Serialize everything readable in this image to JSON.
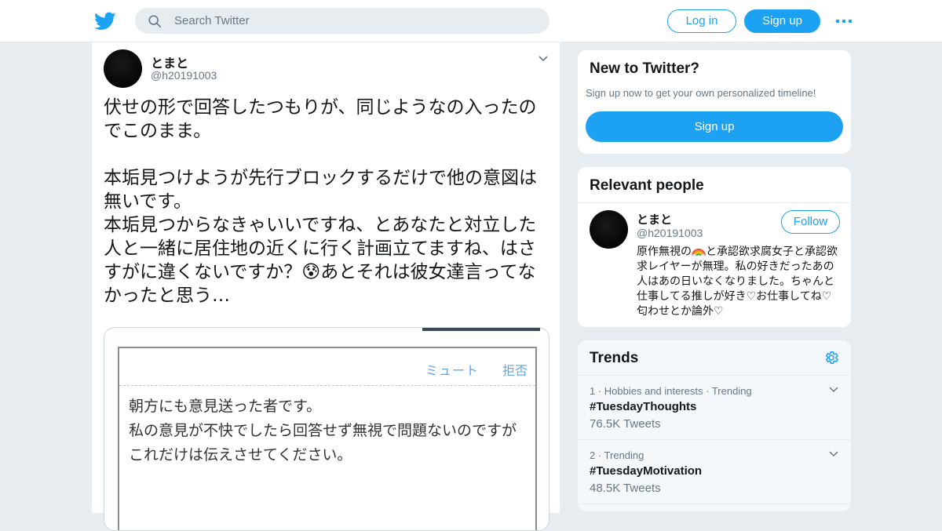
{
  "header": {
    "search_placeholder": "Search Twitter",
    "login_label": "Log in",
    "signup_label": "Sign up"
  },
  "tweet": {
    "name": "とまと",
    "handle": "@h20191003",
    "text": "伏せの形で回答したつもりが、同じようなの入ったのでこのまま。\n\n本垢見つけようが先行ブロックするだけで他の意図は無いです。\n本垢見つからなきゃいいですね、とあなたと対立した人と一緒に居住地の近くに行く計画立てますね、はさすがに違くないですか？😰あとそれは彼女達言ってなかったと思う…",
    "media": {
      "mute_label": "ミュート",
      "reject_label": "拒否",
      "message": "朝方にも意見送った者です。\n私の意見が不快でしたら回答せず無視で問題ないのですがこれだけは伝えさせてください。"
    }
  },
  "sidebar": {
    "new_to_twitter": {
      "title": "New to Twitter?",
      "subtitle": "Sign up now to get your own personalized timeline!",
      "button": "Sign up"
    },
    "relevant_people": {
      "title": "Relevant people",
      "name": "とまと",
      "handle": "@h20191003",
      "follow_label": "Follow",
      "bio_before": "原作無視の",
      "bio_after": "と承認欲求腐女子と承認欲求レイヤーが無理。私の好きだったあの人はあの日いなくなりました。ちゃんと仕事してる推しが好き♡お仕事してね♡匂わせとか論外♡"
    },
    "trends": {
      "title": "Trends",
      "items": [
        {
          "meta": "1 · Hobbies and interests · Trending",
          "tag": "#TuesdayThoughts",
          "count": "76.5K Tweets"
        },
        {
          "meta": "2 · Trending",
          "tag": "#TuesdayMotivation",
          "count": "48.5K Tweets"
        }
      ]
    }
  },
  "colors": {
    "accent": "#1da1f2",
    "background": "#e6ecf0",
    "secondary_text": "#657786"
  },
  "icons": [
    "twitter-bird-icon",
    "search-icon",
    "more-dots-icon",
    "chevron-down-icon",
    "rainbow-icon",
    "gear-icon"
  ]
}
